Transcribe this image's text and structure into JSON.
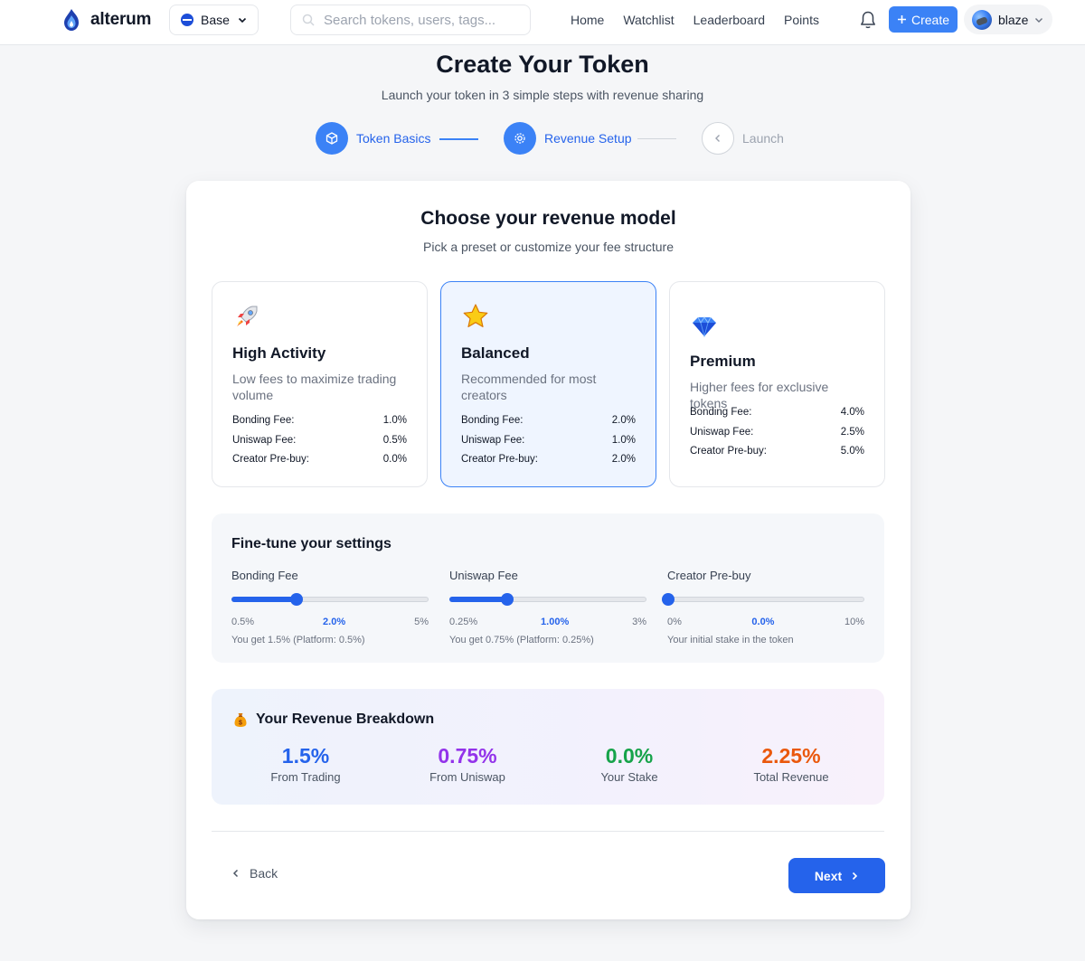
{
  "header": {
    "brand": "alterum",
    "chain": "Base",
    "search_placeholder": "Search tokens, users, tags...",
    "nav": [
      "Home",
      "Watchlist",
      "Leaderboard",
      "Points"
    ],
    "create_label": "Create",
    "username": "blaze"
  },
  "page": {
    "title": "Create Your Token",
    "subtitle": "Launch your token in 3 simple steps with revenue sharing"
  },
  "steps": [
    {
      "label": "Token Basics",
      "state": "complete"
    },
    {
      "label": "Revenue Setup",
      "state": "active"
    },
    {
      "label": "Launch",
      "state": "pending"
    }
  ],
  "card": {
    "title": "Choose your revenue model",
    "subtitle": "Pick a preset or customize your fee structure"
  },
  "presets": [
    {
      "icon": "rocket-icon",
      "name": "High Activity",
      "description": "Low fees to maximize trading volume",
      "selected": false,
      "fees": [
        {
          "label": "Bonding Fee:",
          "value": "1.0%"
        },
        {
          "label": "Uniswap Fee:",
          "value": "0.5%"
        },
        {
          "label": "Creator Pre-buy:",
          "value": "0.0%"
        }
      ]
    },
    {
      "icon": "star-icon",
      "name": "Balanced",
      "description": "Recommended for most creators",
      "selected": true,
      "fees": [
        {
          "label": "Bonding Fee:",
          "value": "2.0%"
        },
        {
          "label": "Uniswap Fee:",
          "value": "1.0%"
        },
        {
          "label": "Creator Pre-buy:",
          "value": "2.0%"
        }
      ]
    },
    {
      "icon": "gem-icon",
      "name": "Premium",
      "description": "Higher fees for exclusive tokens",
      "selected": false,
      "fees": [
        {
          "label": "Bonding Fee:",
          "value": "4.0%"
        },
        {
          "label": "Uniswap Fee:",
          "value": "2.5%"
        },
        {
          "label": "Creator Pre-buy:",
          "value": "5.0%"
        }
      ]
    }
  ],
  "fine_tune": {
    "title": "Fine-tune your settings",
    "controls": [
      {
        "label": "Bonding Fee",
        "min_label": "0.5%",
        "current_label": "2.0%",
        "max_label": "5%",
        "fraction": 0.33,
        "note": "You get 1.5% (Platform: 0.5%)"
      },
      {
        "label": "Uniswap Fee",
        "min_label": "0.25%",
        "current_label": "1.00%",
        "max_label": "3%",
        "fraction": 0.29,
        "note": "You get 0.75% (Platform: 0.25%)"
      },
      {
        "label": "Creator Pre-buy",
        "min_label": "0%",
        "current_label": "0.0%",
        "max_label": "10%",
        "fraction": 0.0,
        "note": "Your initial stake in the token"
      }
    ]
  },
  "breakdown": {
    "icon": "money-bag-icon",
    "title": "Your Revenue Breakdown",
    "stats": [
      {
        "value": "1.5%",
        "label": "From Trading",
        "color": "#2563eb"
      },
      {
        "value": "0.75%",
        "label": "From Uniswap",
        "color": "#9333ea"
      },
      {
        "value": "0.0%",
        "label": "Your Stake",
        "color": "#16a34a"
      },
      {
        "value": "2.25%",
        "label": "Total Revenue",
        "color": "#ea580c"
      }
    ]
  },
  "footer": {
    "back_label": "Back",
    "next_label": "Next"
  }
}
